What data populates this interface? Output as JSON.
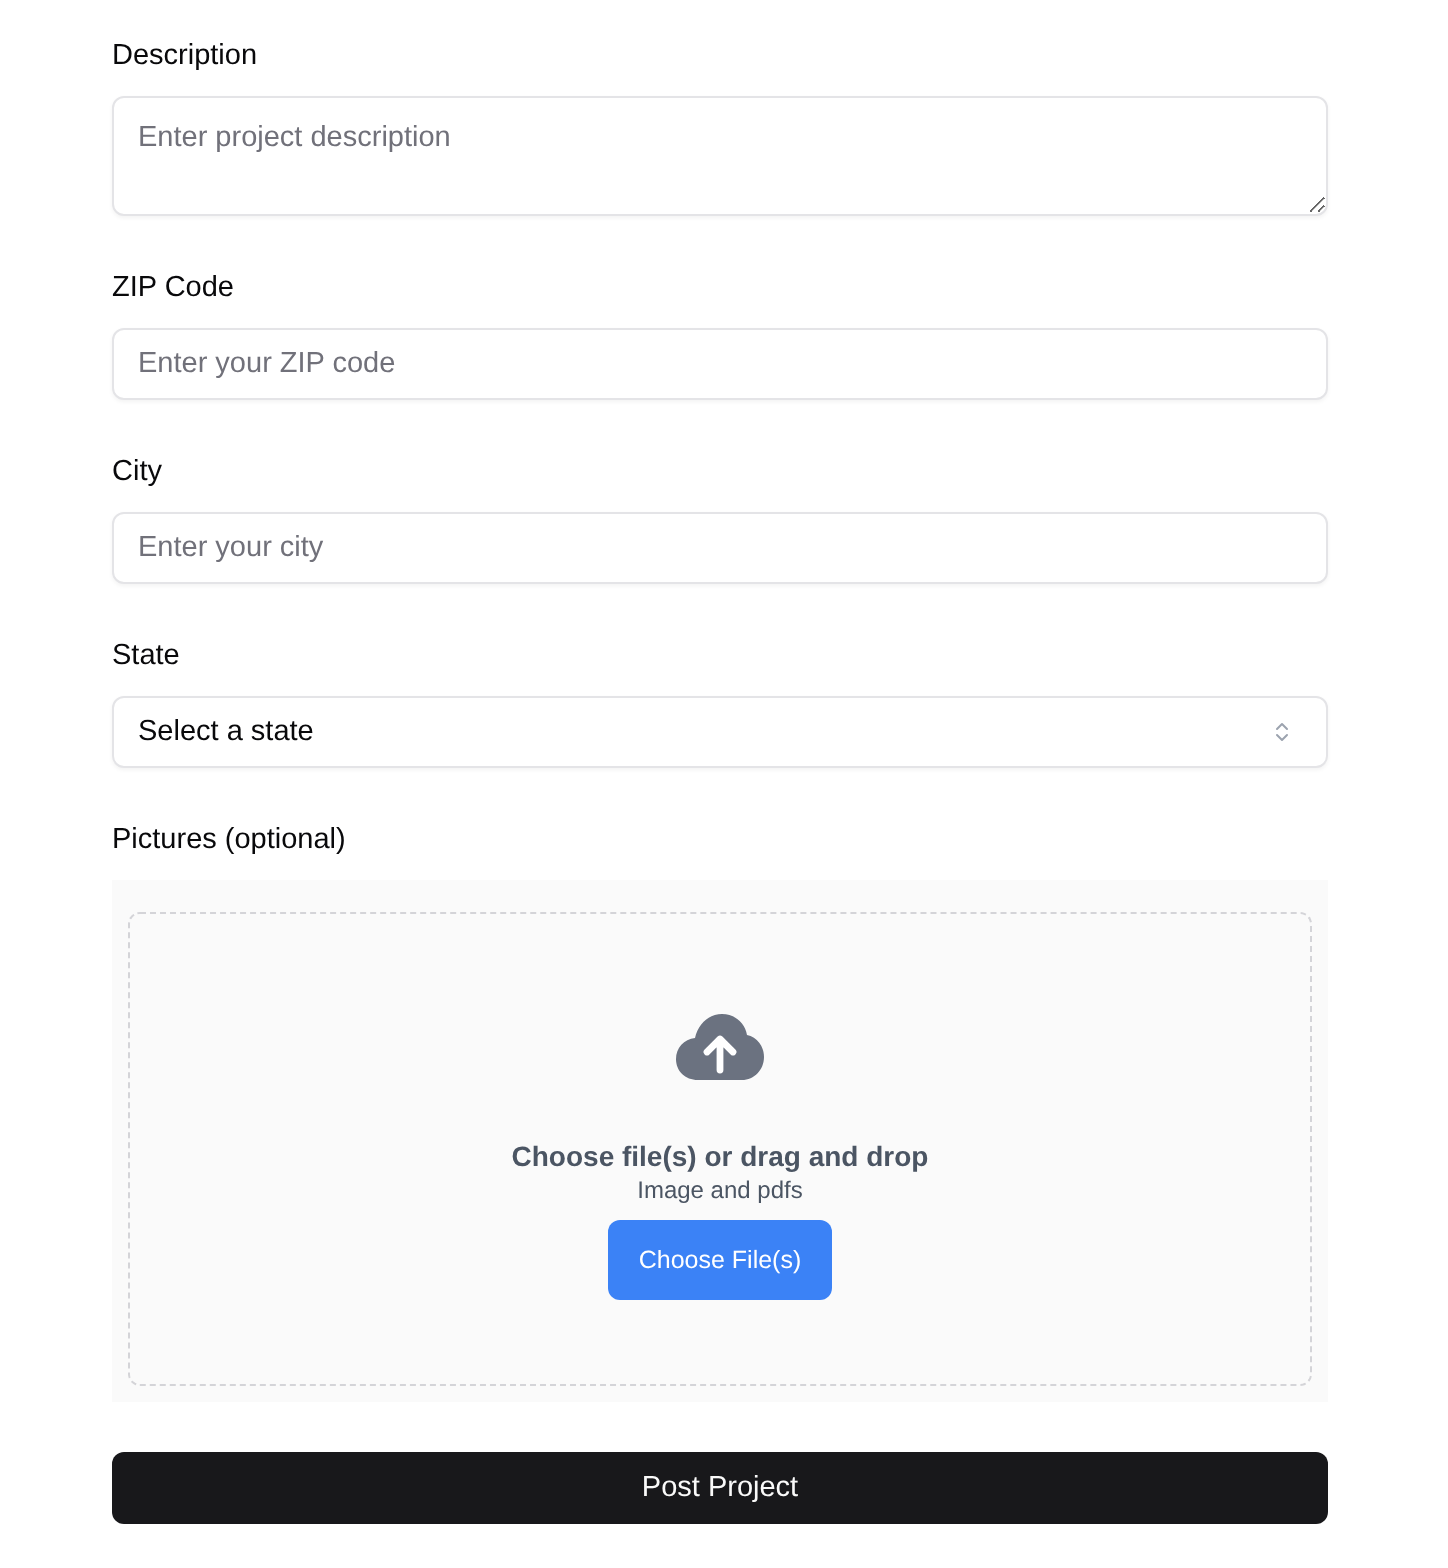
{
  "fields": [
    {
      "kind": "textarea",
      "label": "Description",
      "placeholder": "Enter project description"
    },
    {
      "kind": "input",
      "label": "ZIP Code",
      "placeholder": "Enter your ZIP code"
    },
    {
      "kind": "input",
      "label": "City",
      "placeholder": "Enter your city"
    },
    {
      "kind": "select",
      "label": "State",
      "value": "Select a state"
    }
  ],
  "pictures": {
    "label": "Pictures (optional)",
    "prompt": "Choose file(s) or drag and drop",
    "hint": "Image and pdfs",
    "button": "Choose File(s)"
  },
  "submit": {
    "label": "Post Project"
  }
}
